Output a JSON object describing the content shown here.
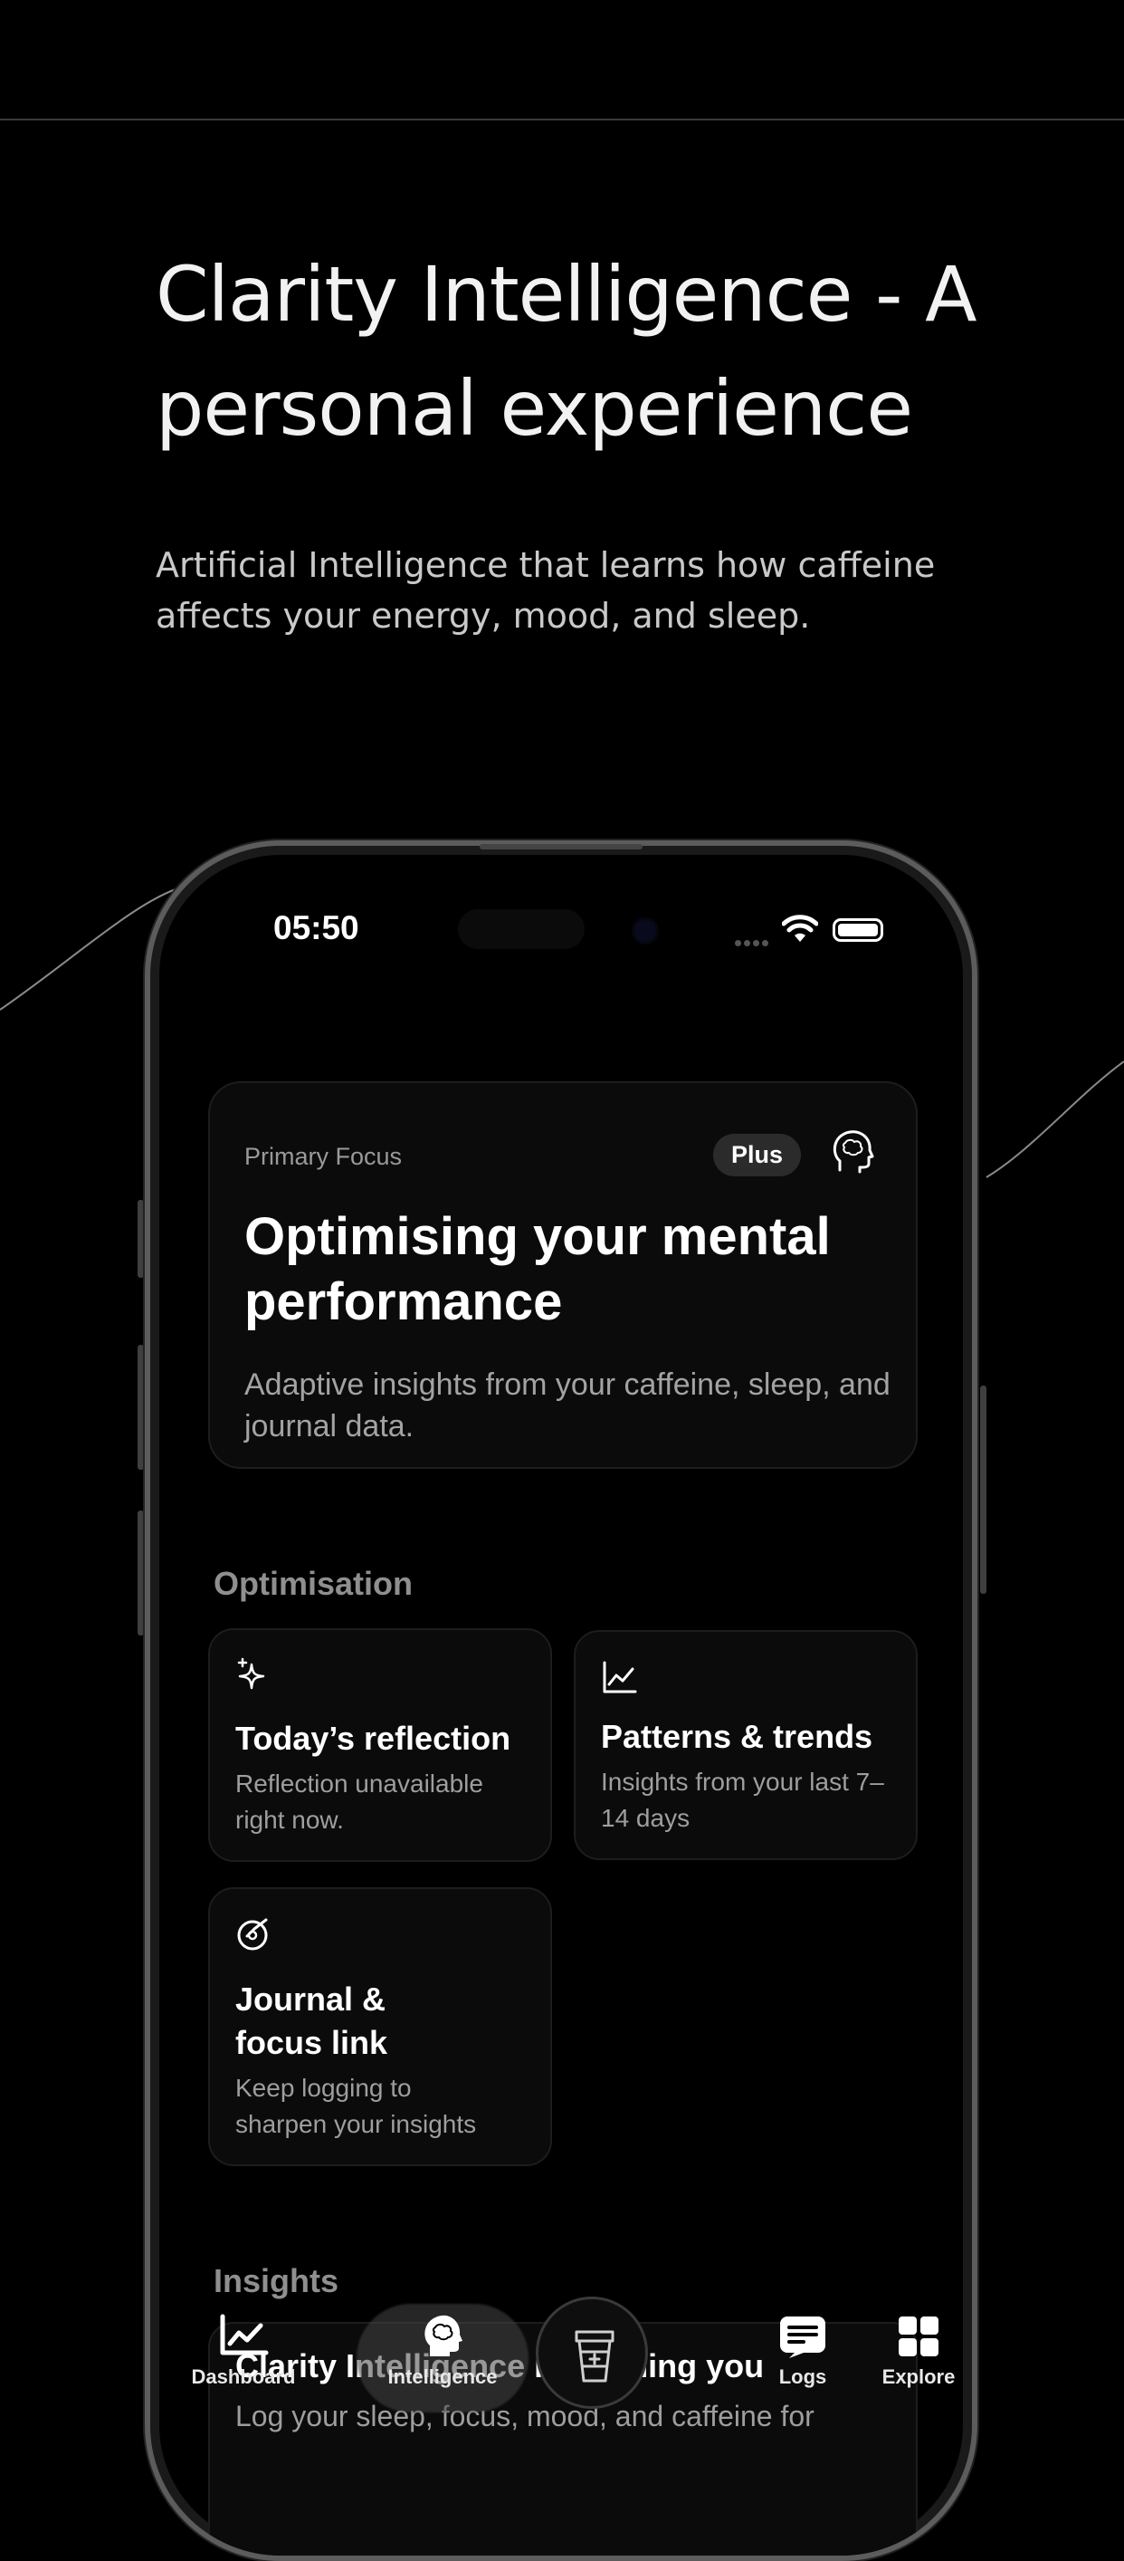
{
  "marketing": {
    "headline": "Clarity Intelligence - A personal experience",
    "subline": "Artificial Intelligence that learns how caffeine affects your energy, mood, and sleep."
  },
  "status_bar": {
    "time": "05:50"
  },
  "focus_card": {
    "eyebrow": "Primary Focus",
    "badge": "Plus",
    "title": "Optimising your mental performance",
    "description": "Adaptive insights from your caffeine, sleep, and journal data."
  },
  "optimisation": {
    "section_title": "Optimisation",
    "tiles": [
      {
        "icon": "sparkles-icon",
        "title": "Today’s reflection",
        "description": "Reflection unavailable right now."
      },
      {
        "icon": "chart-trend-icon",
        "title": "Patterns & trends",
        "description": "Insights from your last 7–14 days"
      },
      {
        "icon": "target-icon",
        "title": "Journal & focus link",
        "description": "Keep logging to sharpen your insights"
      }
    ]
  },
  "insights": {
    "section_title": "Insights",
    "card_title": "Clarity Intelligence is learning you",
    "card_description": "Log your sleep, focus, mood, and caffeine for"
  },
  "tab_bar": {
    "items": [
      {
        "label": "Dashboard",
        "icon": "chart-icon"
      },
      {
        "label": "Intelligence",
        "icon": "brain-icon",
        "active": true
      },
      {
        "label": "",
        "icon": "add-drink-icon"
      },
      {
        "label": "Logs",
        "icon": "logs-icon"
      },
      {
        "label": "Explore",
        "icon": "grid-icon"
      }
    ]
  },
  "colors": {
    "background": "#000000",
    "card": "#0b0b0b",
    "text": "#ffffff",
    "muted": "#9e9e9e"
  }
}
